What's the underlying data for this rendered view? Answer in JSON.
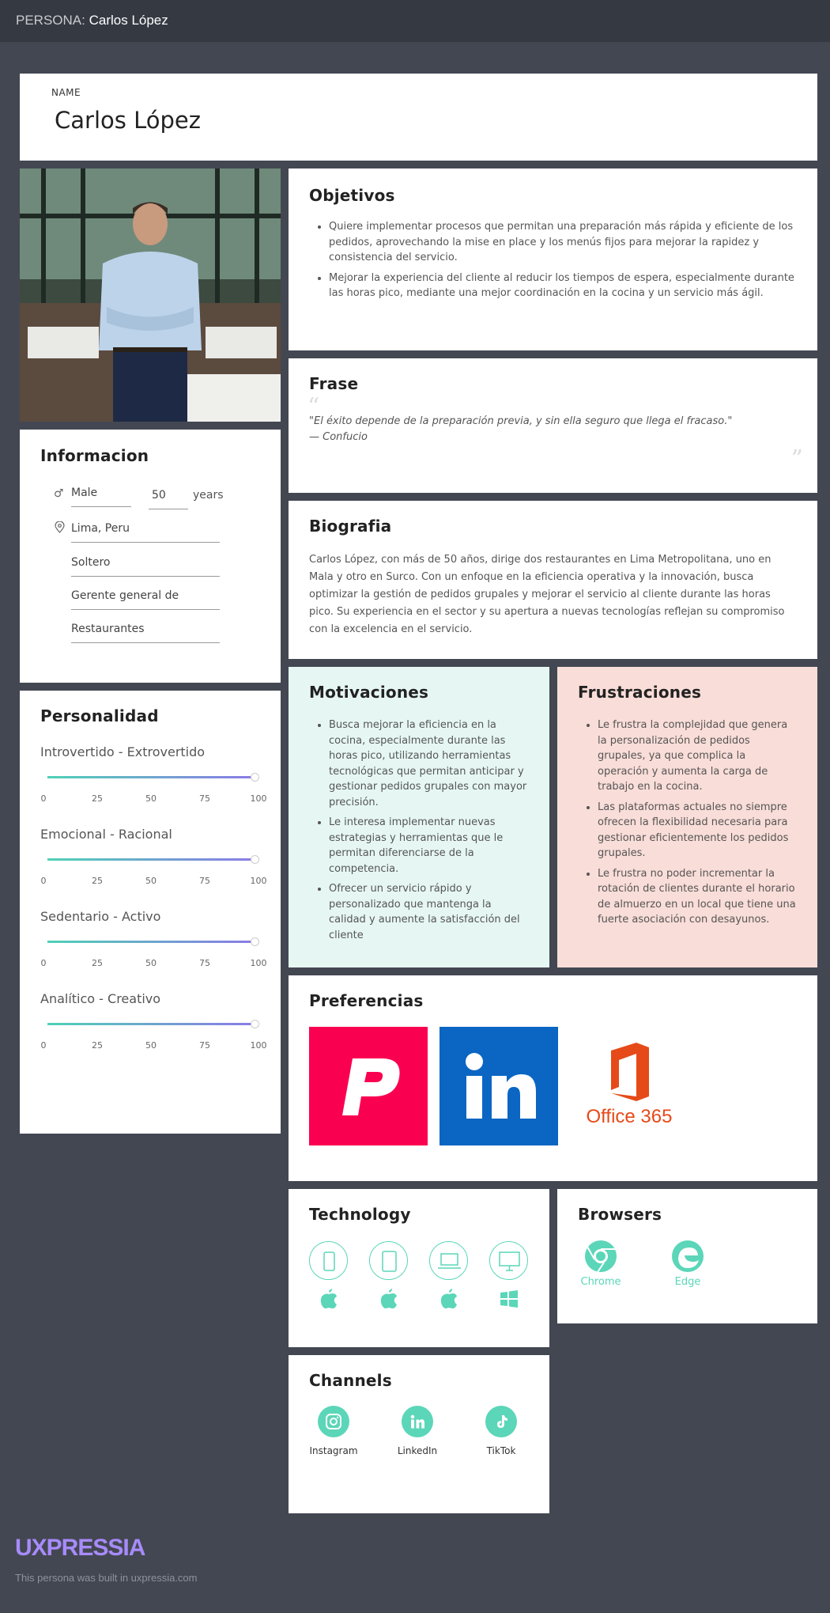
{
  "topbar": {
    "prefix": "PERSONA:",
    "name": "Carlos López"
  },
  "header": {
    "name_label": "NAME",
    "name": "Carlos López"
  },
  "objetivos": {
    "title": "Objetivos",
    "items": [
      "Quiere implementar procesos que permitan una preparación más rápida y eficiente de los pedidos, aprovechando la mise en place y los menús fijos para mejorar la rapidez y consistencia del servicio.",
      "Mejorar la experiencia del cliente al reducir los tiempos de espera, especialmente durante las horas pico, mediante una mejor coordinación en la cocina y un servicio más ágil."
    ]
  },
  "frase": {
    "title": "Frase",
    "quote": "\"El éxito depende de la preparación previa, y sin ella seguro que llega el fracaso.\"",
    "author": "— Confucio"
  },
  "biografia": {
    "title": "Biografia",
    "text": "Carlos López, con más de 50 años, dirige dos restaurantes en Lima Metropolitana, uno en Mala y otro en Surco. Con un enfoque en la eficiencia operativa y la innovación, busca optimizar la gestión de pedidos grupales y mejorar el servicio al cliente durante las horas pico. Su experiencia en el sector y su apertura a nuevas tecnologías reflejan su compromiso con la excelencia en el servicio."
  },
  "informacion": {
    "title": "Informacion",
    "gender": "Male",
    "age": "50",
    "age_unit": "years",
    "location": "Lima, Peru",
    "status": "Soltero",
    "job_line1": "Gerente general de",
    "job_line2": "Restaurantes"
  },
  "personalidad": {
    "title": "Personalidad",
    "ticks": [
      "0",
      "25",
      "50",
      "75",
      "100"
    ],
    "traits": [
      {
        "label": "Introvertido  - Extrovertido",
        "value": 100
      },
      {
        "label": "Emocional - Racional",
        "value": 100
      },
      {
        "label": "Sedentario - Activo",
        "value": 100
      },
      {
        "label": "Analítico - Creativo",
        "value": 100
      }
    ]
  },
  "motivaciones": {
    "title": "Motivaciones",
    "items": [
      "Busca mejorar la eficiencia en la cocina, especialmente durante las horas pico, utilizando herramientas tecnológicas que permitan anticipar y gestionar pedidos grupales con mayor precisión.",
      "Le interesa implementar nuevas estrategias y herramientas que le permitan diferenciarse de la competencia.",
      "Ofrecer un servicio rápido y personalizado que mantenga la calidad y aumente la satisfacción del cliente"
    ]
  },
  "frustraciones": {
    "title": "Frustraciones",
    "items": [
      "Le frustra la complejidad que genera la personalización de pedidos grupales, ya que complica la operación y aumenta la carga de trabajo en la cocina.",
      "Las plataformas actuales no siempre ofrecen la flexibilidad necesaria para gestionar eficientemente los pedidos grupales.",
      "Le frustra no poder incrementar la rotación de clientes durante el horario de almuerzo en un local que tiene una fuerte asociación con desayunos."
    ]
  },
  "preferencias": {
    "title": "Preferencias",
    "office_text": "Office 365"
  },
  "technology": {
    "title": "Technology"
  },
  "browsers": {
    "title": "Browsers",
    "items": [
      "Chrome",
      "Edge"
    ]
  },
  "channels": {
    "title": "Channels",
    "items": [
      "Instagram",
      "LinkedIn",
      "TikTok"
    ]
  },
  "footer": {
    "logo": "UXPRESSIA",
    "caption": "This persona was built in uxpressia.com"
  },
  "colors": {
    "accent": "#5bd6b8",
    "motivaciones_bg": "#e6f7f3",
    "frustraciones_bg": "#f9ddd8",
    "page_bg": "#434752"
  }
}
